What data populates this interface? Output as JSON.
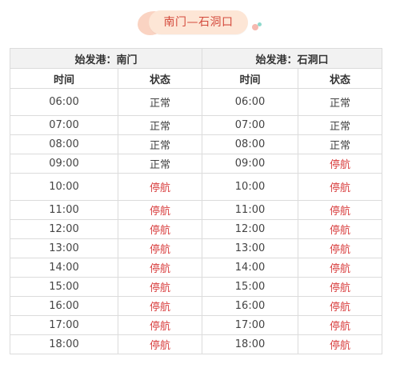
{
  "banner": {
    "title": "南门—石洞口"
  },
  "ports": [
    {
      "label": "始发港：南门"
    },
    {
      "label": "始发港：石洞口"
    }
  ],
  "columns": {
    "time": "时间",
    "status": "状态"
  },
  "colors": {
    "normal": "#444444",
    "suspended": "#d94040",
    "banner_text": "#d44a3c",
    "banner_bg": "#fde6d6"
  },
  "rows": [
    {
      "a_time": "06:00",
      "a_status": "正常",
      "a_state": "normal",
      "b_time": "06:00",
      "b_status": "正常",
      "b_state": "normal"
    },
    {
      "a_time": "07:00",
      "a_status": "正常",
      "a_state": "normal",
      "b_time": "07:00",
      "b_status": "正常",
      "b_state": "normal"
    },
    {
      "a_time": "08:00",
      "a_status": "正常",
      "a_state": "normal",
      "b_time": "08:00",
      "b_status": "正常",
      "b_state": "normal"
    },
    {
      "a_time": "09:00",
      "a_status": "正常",
      "a_state": "normal",
      "b_time": "09:00",
      "b_status": "停航",
      "b_state": "suspended"
    },
    {
      "a_time": "10:00",
      "a_status": "停航",
      "a_state": "suspended",
      "b_time": "10:00",
      "b_status": "停航",
      "b_state": "suspended"
    },
    {
      "a_time": "11:00",
      "a_status": "停航",
      "a_state": "suspended",
      "b_time": "11:00",
      "b_status": "停航",
      "b_state": "suspended"
    },
    {
      "a_time": "12:00",
      "a_status": "停航",
      "a_state": "suspended",
      "b_time": "12:00",
      "b_status": "停航",
      "b_state": "suspended"
    },
    {
      "a_time": "13:00",
      "a_status": "停航",
      "a_state": "suspended",
      "b_time": "13:00",
      "b_status": "停航",
      "b_state": "suspended"
    },
    {
      "a_time": "14:00",
      "a_status": "停航",
      "a_state": "suspended",
      "b_time": "14:00",
      "b_status": "停航",
      "b_state": "suspended"
    },
    {
      "a_time": "15:00",
      "a_status": "停航",
      "a_state": "suspended",
      "b_time": "15:00",
      "b_status": "停航",
      "b_state": "suspended"
    },
    {
      "a_time": "16:00",
      "a_status": "停航",
      "a_state": "suspended",
      "b_time": "16:00",
      "b_status": "停航",
      "b_state": "suspended"
    },
    {
      "a_time": "17:00",
      "a_status": "停航",
      "a_state": "suspended",
      "b_time": "17:00",
      "b_status": "停航",
      "b_state": "suspended"
    },
    {
      "a_time": "18:00",
      "a_status": "停航",
      "a_state": "suspended",
      "b_time": "18:00",
      "b_status": "停航",
      "b_state": "suspended"
    }
  ]
}
